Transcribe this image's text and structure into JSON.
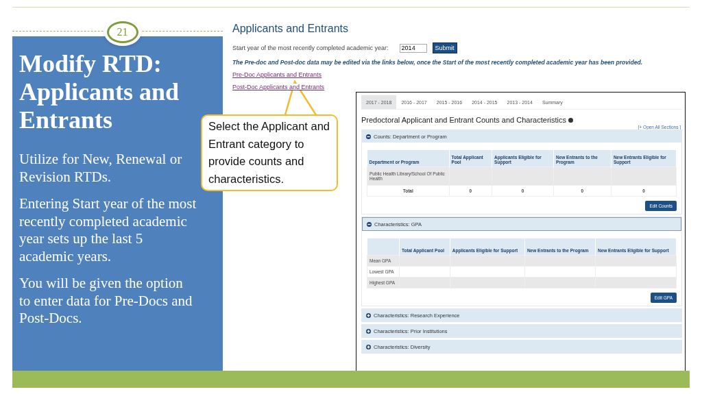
{
  "slide": {
    "number": "21",
    "title": "Modify RTD: Applicants and Entrants",
    "paragraphs": [
      "Utilize for New, Renewal or Revision RTDs.",
      "Entering Start year of the most recently completed academic year sets up the last 5 academic years.",
      "You will be given the option to enter data for Pre-Docs and Post-Docs."
    ]
  },
  "callout": {
    "text": "Select the Applicant and Entrant category to provide counts and characteristics."
  },
  "page": {
    "title": "Applicants and Entrants",
    "year_label": "Start year of the most recently completed academic year:",
    "year_value": "2014",
    "submit": "Submit",
    "note": "The Pre-doc and Post-doc data may be edited via the links below, once the Start of the most recently completed academic year has been provided.",
    "links": [
      "Pre-Doc Applicants and Entrants",
      "Post-Doc Applicants and Entrants"
    ]
  },
  "panel": {
    "tabs": [
      {
        "label": "2017 - 2018",
        "selected": true
      },
      {
        "label": "2016 - 2017",
        "selected": false
      },
      {
        "label": "2015 - 2016",
        "selected": false
      },
      {
        "label": "2014 - 2015",
        "selected": false
      },
      {
        "label": "2013 - 2014",
        "selected": false
      },
      {
        "label": "Summary",
        "selected": false
      }
    ],
    "heading": "Predoctoral Applicant and Entrant Counts and Characteristics",
    "open_all": "[+ Open All Sections ]",
    "sections": [
      {
        "title": "Counts: Department or Program",
        "expanded": true,
        "label_column": "Department or Program",
        "columns": [
          "Total Applicant Pool",
          "Applicants Eligible for Support",
          "New Entrants to the Program",
          "New Entrants Eligible for Support"
        ],
        "rows": [
          {
            "kind": "data",
            "label": "Public Health Library/School Of Public Health"
          },
          {
            "kind": "total",
            "label": "Total",
            "values": [
              "0",
              "0",
              "0",
              "0"
            ]
          }
        ],
        "button": "Edit Counts"
      },
      {
        "title": "Characteristics: GPA",
        "expanded": true,
        "columns": [
          "Total Applicant Pool",
          "Applicants Eligible for Support",
          "New Entrants to the Program",
          "New Entrants Eligible for Support"
        ],
        "rows": [
          {
            "kind": "data",
            "label": "Mean GPA"
          },
          {
            "kind": "data",
            "label": "Lowest GPA"
          },
          {
            "kind": "data",
            "label": "Highest GPA"
          }
        ],
        "button": "Edit GPA"
      },
      {
        "title": "Characteristics: Research Experience",
        "expanded": false
      },
      {
        "title": "Characteristics: Prior Institutions",
        "expanded": false
      },
      {
        "title": "Characteristics: Diversity",
        "expanded": false
      }
    ]
  }
}
